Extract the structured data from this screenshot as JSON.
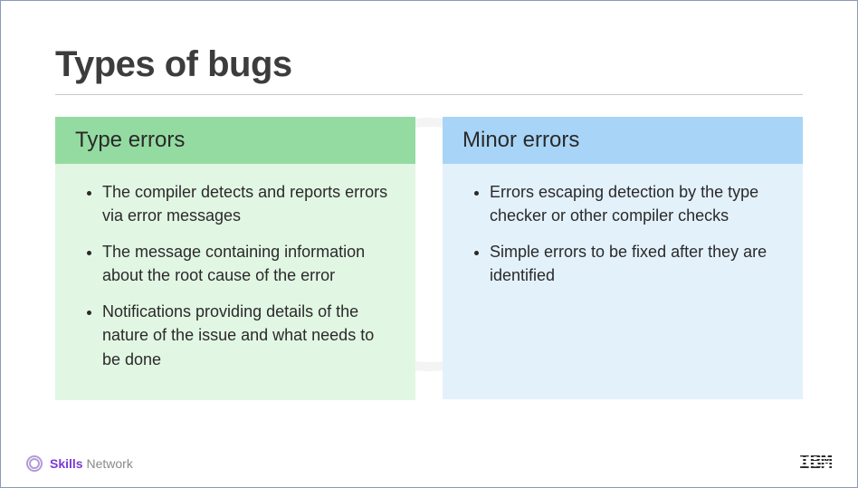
{
  "title": "Types of bugs",
  "columns": [
    {
      "heading": "Type errors",
      "items": [
        "The compiler detects and reports errors via error messages",
        "The message containing information about the root cause of the error",
        "Notifications providing details of the nature of the issue and what needs to be done"
      ]
    },
    {
      "heading": "Minor errors",
      "items": [
        "Errors escaping detection by the type checker or other compiler checks",
        "Simple errors to be fixed after they are identified"
      ]
    }
  ],
  "footer": {
    "brand_bold": "Skills",
    "brand_light": "Network",
    "logo": "IBM"
  }
}
